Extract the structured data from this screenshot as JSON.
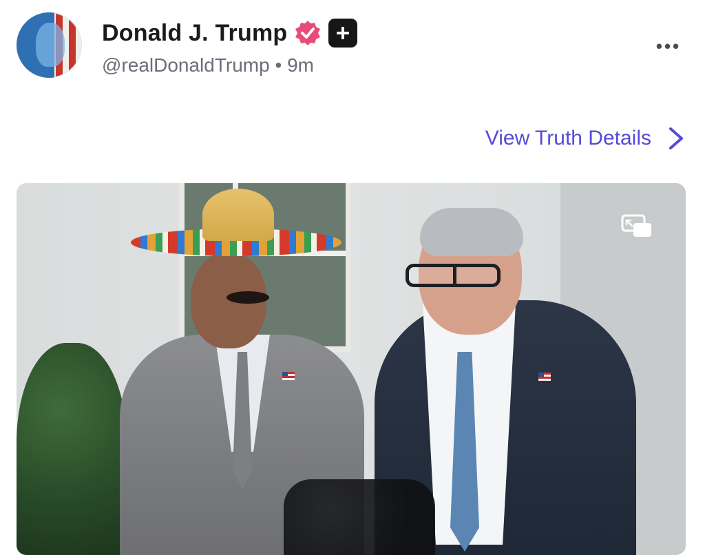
{
  "post": {
    "author_name": "Donald J. Trump",
    "handle": "@realDonaldTrump",
    "separator": "•",
    "age": "9m",
    "more_label": "•••",
    "view_details_label": "View Truth Details"
  },
  "icons": {
    "verified": "verified-icon",
    "plus_badge": "plus-badge-icon",
    "more": "more-options-icon",
    "chevron": "chevron-right-icon",
    "pip": "picture-in-picture-icon"
  },
  "colors": {
    "accent": "#5749d6",
    "verified": "#e94b79",
    "text_primary": "#1b1b1f",
    "text_secondary": "#6b6d78"
  }
}
